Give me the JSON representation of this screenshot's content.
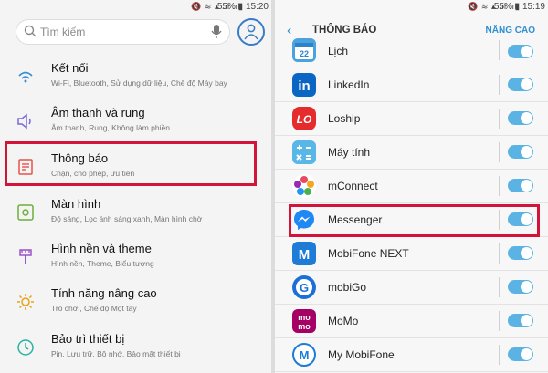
{
  "left": {
    "status": {
      "battery": "55%",
      "time": "15:20"
    },
    "search": {
      "placeholder": "Tìm kiếm"
    },
    "settings": [
      {
        "title": "Kết nối",
        "subtitle": "Wi-Fi, Bluetooth, Sử dụng dữ liệu, Chế độ Máy bay",
        "icon": "connections-icon"
      },
      {
        "title": "Âm thanh và rung",
        "subtitle": "Âm thanh, Rung, Không làm phiền",
        "icon": "sound-icon"
      },
      {
        "title": "Thông báo",
        "subtitle": "Chặn, cho phép, ưu tiên",
        "icon": "notifications-icon"
      },
      {
        "title": "Màn hình",
        "subtitle": "Độ sáng, Lọc ánh sáng xanh, Màn hình chờ",
        "icon": "display-icon"
      },
      {
        "title": "Hình nền và theme",
        "subtitle": "Hình nền, Theme, Biểu tượng",
        "icon": "wallpaper-icon"
      },
      {
        "title": "Tính năng nâng cao",
        "subtitle": "Trò chơi, Chế độ Một tay",
        "icon": "advanced-features-icon"
      },
      {
        "title": "Bảo trì thiết bị",
        "subtitle": "Pin, Lưu trữ, Bộ nhớ, Bảo mật thiết bị",
        "icon": "device-maintenance-icon"
      }
    ]
  },
  "right": {
    "status": {
      "battery": "55%",
      "time": "15:19"
    },
    "header": {
      "title": "THÔNG BÁO",
      "action": "NĂNG CAO"
    },
    "apps": [
      {
        "name": "Lịch",
        "icon_text": "22",
        "color": "#4aa3df",
        "toggle": true
      },
      {
        "name": "LinkedIn",
        "icon_text": "in",
        "color": "#0a66c2",
        "toggle": true
      },
      {
        "name": "Loship",
        "icon_text": "LO",
        "color": "#e52b2b",
        "toggle": true
      },
      {
        "name": "Máy tính",
        "icon_text": "±",
        "color": "#59b7e8",
        "toggle": true
      },
      {
        "name": "mConnect",
        "icon_text": "",
        "color": "#ffffff",
        "toggle": true
      },
      {
        "name": "Messenger",
        "icon_text": "",
        "color": "#1e88f5",
        "toggle": true
      },
      {
        "name": "MobiFone NEXT",
        "icon_text": "M",
        "color": "#1e7bd6",
        "toggle": true
      },
      {
        "name": "mobiGo",
        "icon_text": "G",
        "color": "#1c6fd6",
        "toggle": true
      },
      {
        "name": "MoMo",
        "icon_text": "mo",
        "color": "#a50064",
        "toggle": true
      },
      {
        "name": "My MobiFone",
        "icon_text": "M",
        "color": "#1e7bd6",
        "toggle": true
      }
    ]
  }
}
